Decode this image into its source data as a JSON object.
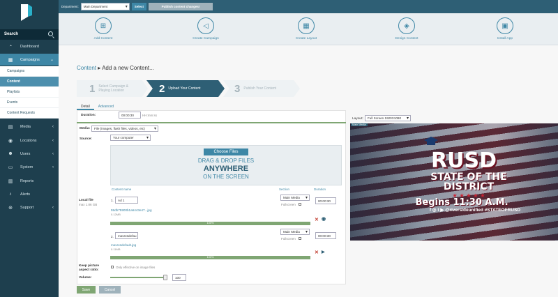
{
  "sidebar": {
    "search_label": "Search",
    "items": [
      {
        "label": "Dashboard",
        "icon": "speedometer-icon"
      },
      {
        "label": "Campaigns",
        "icon": "calendar-icon",
        "active": true
      },
      {
        "label": "Media",
        "icon": "film-icon"
      },
      {
        "label": "Locations",
        "icon": "pin-icon"
      },
      {
        "label": "Users",
        "icon": "users-icon"
      },
      {
        "label": "System",
        "icon": "monitor-icon"
      },
      {
        "label": "Reports",
        "icon": "report-icon"
      },
      {
        "label": "Alerts",
        "icon": "bell-icon"
      },
      {
        "label": "Support",
        "icon": "support-icon"
      }
    ],
    "campaign_sub": [
      "Campaigns",
      "Content",
      "Playlists",
      "Events",
      "Content Requests"
    ]
  },
  "topbar": {
    "department_label": "Department:",
    "department_value": "Main Department",
    "select_label": "Select",
    "publish_label": "Publish content changes!"
  },
  "actions": [
    {
      "label": "Add Content",
      "icon": "add-content-icon"
    },
    {
      "label": "Create Campaign",
      "icon": "megaphone-icon"
    },
    {
      "label": "Create Layout",
      "icon": "layout-icon"
    },
    {
      "label": "Design Content",
      "icon": "design-icon"
    },
    {
      "label": "Install App",
      "icon": "app-icon"
    }
  ],
  "breadcrumb": {
    "link": "Content",
    "current": "Add a new Content..."
  },
  "steps": [
    {
      "num": "1",
      "label": "Select Campaign & Playing Location"
    },
    {
      "num": "2",
      "label": "Upload Your Content"
    },
    {
      "num": "3",
      "label": "Publish Your Content"
    }
  ],
  "tabs": [
    "Detail",
    "Advanced"
  ],
  "form": {
    "duration_label": "Duration:",
    "duration_value": "00:00:30",
    "duration_hint": "HH:mm:ss",
    "media_label": "Media:",
    "media_value": "File (images, flash files, videos, etc)",
    "source_label": "Source:",
    "source_value": "Your computer",
    "choose_files": "Choose Files",
    "drag_line": "DRAG & DROP FILES",
    "anywhere_line": "ANYWHERE",
    "screen_line": "ON THE SCREEN",
    "local_file_label": "Local file",
    "local_file_max": "max 1.86 GB",
    "col_content_name": "Content name",
    "col_section": "Section",
    "col_duration": "Duration",
    "files": [
      {
        "index": "1.",
        "name": "Ad 1",
        "filename": "59db75900b1a6443e47...jpg",
        "size": "0.12MB",
        "section": "Main Media",
        "fullscreen_label": "Fullscreen",
        "duration": "00:00:30",
        "progress": "100%"
      },
      {
        "index": "2.",
        "name": "mavresdefau",
        "filename": "mavresdefault.jpg",
        "size": "0.11MB",
        "section": "Main Media",
        "fullscreen_label": "Fullscreen",
        "duration": "00:00:30",
        "progress": "100%"
      }
    ],
    "keep_ratio_label": "Keep picture aspect ratio:",
    "keep_ratio_hint": "Only effective on image files",
    "volume_label": "Volume:",
    "volume_value": "100",
    "save_label": "Save",
    "cancel_label": "Cancel"
  },
  "layout": {
    "label": "Layout:",
    "value": "Full Screen 1920X1080",
    "region_tag": "Main Media"
  },
  "preview": {
    "rusd": "RUSD",
    "state_of_the": "STATE OF THE",
    "district": "DISTRICT",
    "stars": "★ ★ ★ ★ ★",
    "begins": "Begins 11:30 A.M.",
    "social": "f ◎ t ▶ @riversideunified #STATEOFRUSD"
  },
  "colors": {
    "sidebar": "#1e3f4e",
    "accent": "#3e87a6",
    "topbar": "#2e5f75",
    "green": "#7fa673"
  }
}
